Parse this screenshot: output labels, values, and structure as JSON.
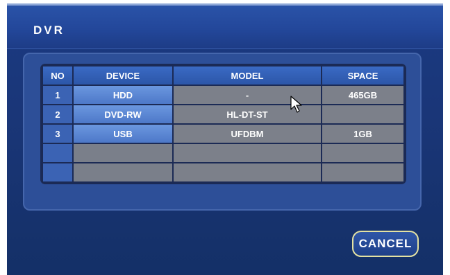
{
  "window": {
    "title": "DVR"
  },
  "table": {
    "headers": {
      "no": "NO",
      "device": "DEVICE",
      "model": "MODEL",
      "space": "SPACE"
    },
    "rows": [
      {
        "no": "1",
        "device": "HDD",
        "model": "-",
        "space": "465GB"
      },
      {
        "no": "2",
        "device": "DVD-RW",
        "model": "HL-DT-ST",
        "space": ""
      },
      {
        "no": "3",
        "device": "USB",
        "model": "UFDBM",
        "space": "1GB"
      },
      {
        "no": "",
        "device": "",
        "model": "",
        "space": ""
      },
      {
        "no": "",
        "device": "",
        "model": "",
        "space": ""
      }
    ]
  },
  "buttons": {
    "cancel_label": "CANCEL"
  },
  "icons": {
    "cursor": "mouse-pointer-icon"
  },
  "colors": {
    "accent_border": "#e4e2a2",
    "title_bar": "#23479a",
    "background": "#1a3678"
  }
}
